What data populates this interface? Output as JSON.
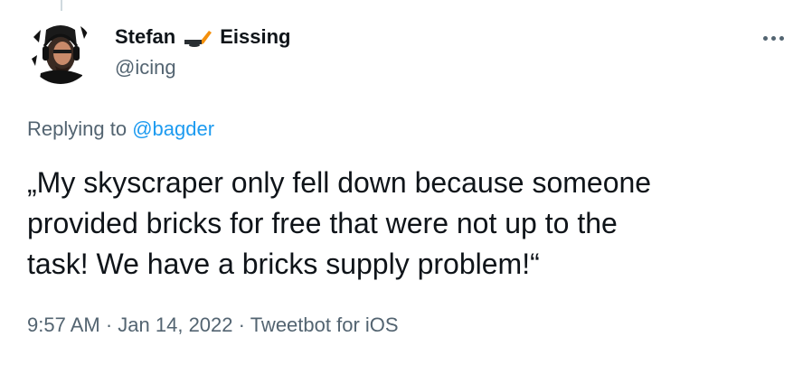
{
  "author": {
    "display_name_first": "Stefan",
    "display_name_last": "Eissing",
    "name_emoji": "hockey-stick-emoji",
    "handle": "@icing",
    "avatar_icon": "profile-photo-avatar"
  },
  "more_icon": "more-options-ellipsis-icon",
  "reply": {
    "prefix": "Replying to",
    "mention": "@bagder"
  },
  "tweet": {
    "lines": [
      "„My skyscraper only fell down because someone",
      "provided bricks for free that were not up to the",
      "task! We have a bricks supply problem!“"
    ]
  },
  "meta": {
    "time": "9:57 AM",
    "separator": "·",
    "date": "Jan 14, 2022",
    "source": "Tweetbot for iOS"
  },
  "colors": {
    "text": "#0f1419",
    "secondary": "#536471",
    "link": "#1d9bf0"
  }
}
